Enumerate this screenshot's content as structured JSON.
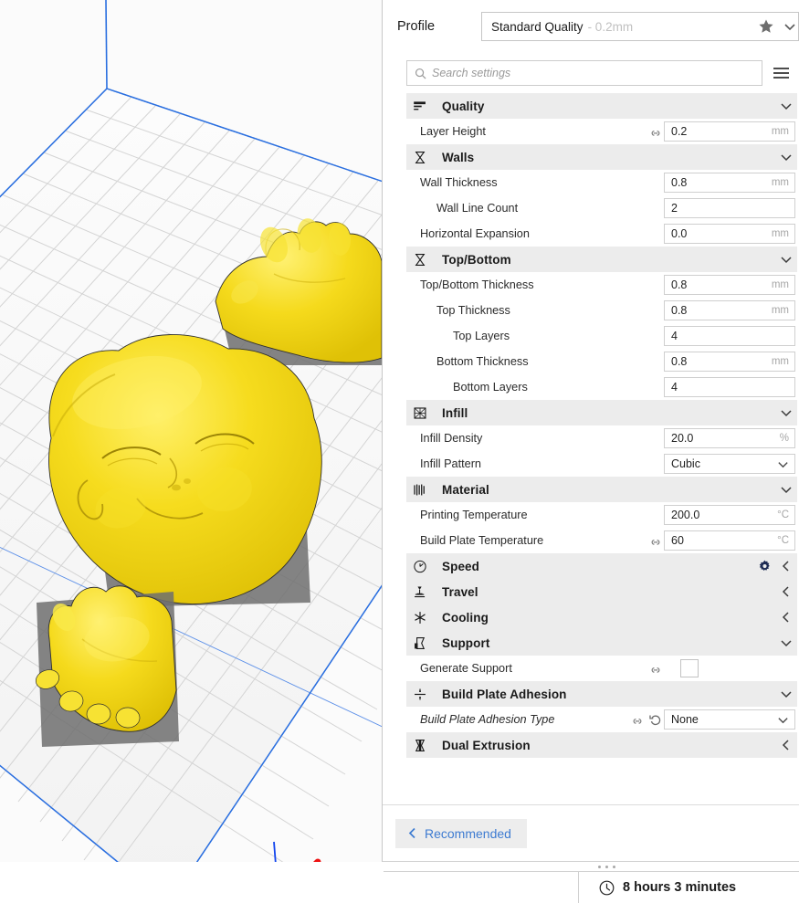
{
  "viewport": {
    "name": "3d-build-plate-viewport",
    "background_color": "#fbfbfb",
    "grid_color": "#d8d8d8",
    "plate_outline_color": "#1f5fd8",
    "model_color": "#f0d313",
    "model_shadow_color": "#6b6b6b",
    "axes": [
      {
        "name": "x-axis",
        "color": "#ee1111"
      },
      {
        "name": "y-axis",
        "color": "#11dd11"
      },
      {
        "name": "z-axis",
        "color": "#1144ee"
      }
    ]
  },
  "profile": {
    "label": "Profile",
    "selected": "Standard Quality",
    "variant": "- 0.2mm",
    "star_title": "Favorite"
  },
  "search": {
    "placeholder": "Search settings",
    "value": ""
  },
  "settings": [
    {
      "type": "category",
      "name": "quality",
      "label": "Quality",
      "icon": "quality-icon",
      "expanded": true,
      "has_gear": false
    },
    {
      "type": "setting",
      "name": "layer-height",
      "label": "Layer Height",
      "indent": 0,
      "control": "text",
      "value": "0.2",
      "unit": "mm",
      "linked": true,
      "reverted": false,
      "italic": false
    },
    {
      "type": "category",
      "name": "walls",
      "label": "Walls",
      "icon": "walls-icon",
      "expanded": true,
      "has_gear": false
    },
    {
      "type": "setting",
      "name": "wall-thickness",
      "label": "Wall Thickness",
      "indent": 0,
      "control": "text",
      "value": "0.8",
      "unit": "mm",
      "linked": false,
      "reverted": false,
      "italic": false
    },
    {
      "type": "setting",
      "name": "wall-line-count",
      "label": "Wall Line Count",
      "indent": 1,
      "control": "text",
      "value": "2",
      "unit": "",
      "linked": false,
      "reverted": false,
      "italic": false
    },
    {
      "type": "setting",
      "name": "horizontal-expansion",
      "label": "Horizontal Expansion",
      "indent": 0,
      "control": "text",
      "value": "0.0",
      "unit": "mm",
      "linked": false,
      "reverted": false,
      "italic": false
    },
    {
      "type": "category",
      "name": "top-bottom",
      "label": "Top/Bottom",
      "icon": "top-bottom-icon",
      "expanded": true,
      "has_gear": false
    },
    {
      "type": "setting",
      "name": "top-bottom-thickness",
      "label": "Top/Bottom Thickness",
      "indent": 0,
      "control": "text",
      "value": "0.8",
      "unit": "mm",
      "linked": false,
      "reverted": false,
      "italic": false
    },
    {
      "type": "setting",
      "name": "top-thickness",
      "label": "Top Thickness",
      "indent": 1,
      "control": "text",
      "value": "0.8",
      "unit": "mm",
      "linked": false,
      "reverted": false,
      "italic": false
    },
    {
      "type": "setting",
      "name": "top-layers",
      "label": "Top Layers",
      "indent": 2,
      "control": "text",
      "value": "4",
      "unit": "",
      "linked": false,
      "reverted": false,
      "italic": false
    },
    {
      "type": "setting",
      "name": "bottom-thickness",
      "label": "Bottom Thickness",
      "indent": 1,
      "control": "text",
      "value": "0.8",
      "unit": "mm",
      "linked": false,
      "reverted": false,
      "italic": false
    },
    {
      "type": "setting",
      "name": "bottom-layers",
      "label": "Bottom Layers",
      "indent": 2,
      "control": "text",
      "value": "4",
      "unit": "",
      "linked": false,
      "reverted": false,
      "italic": false
    },
    {
      "type": "category",
      "name": "infill",
      "label": "Infill",
      "icon": "infill-icon",
      "expanded": true,
      "has_gear": false
    },
    {
      "type": "setting",
      "name": "infill-density",
      "label": "Infill Density",
      "indent": 0,
      "control": "text",
      "value": "20.0",
      "unit": "%",
      "linked": false,
      "reverted": false,
      "italic": false
    },
    {
      "type": "setting",
      "name": "infill-pattern",
      "label": "Infill Pattern",
      "indent": 0,
      "control": "dropdown",
      "value": "Cubic",
      "unit": "",
      "linked": false,
      "reverted": false,
      "italic": false
    },
    {
      "type": "category",
      "name": "material",
      "label": "Material",
      "icon": "material-icon",
      "expanded": true,
      "has_gear": false
    },
    {
      "type": "setting",
      "name": "printing-temperature",
      "label": "Printing Temperature",
      "indent": 0,
      "control": "text",
      "value": "200.0",
      "unit": "°C",
      "linked": false,
      "reverted": false,
      "italic": false
    },
    {
      "type": "setting",
      "name": "build-plate-temperature",
      "label": "Build Plate Temperature",
      "indent": 0,
      "control": "text",
      "value": "60",
      "unit": "°C",
      "linked": true,
      "reverted": false,
      "italic": false
    },
    {
      "type": "category",
      "name": "speed",
      "label": "Speed",
      "icon": "speed-icon",
      "expanded": false,
      "has_gear": true
    },
    {
      "type": "category",
      "name": "travel",
      "label": "Travel",
      "icon": "travel-icon",
      "expanded": false,
      "has_gear": false
    },
    {
      "type": "category",
      "name": "cooling",
      "label": "Cooling",
      "icon": "cooling-icon",
      "expanded": false,
      "has_gear": false
    },
    {
      "type": "category",
      "name": "support",
      "label": "Support",
      "icon": "support-icon",
      "expanded": true,
      "has_gear": false
    },
    {
      "type": "setting",
      "name": "generate-support",
      "label": "Generate Support",
      "indent": 0,
      "control": "checkbox",
      "value": "",
      "unit": "",
      "checked": false,
      "linked": true,
      "reverted": false,
      "italic": false
    },
    {
      "type": "category",
      "name": "build-plate-adhesion",
      "label": "Build Plate Adhesion",
      "icon": "adhesion-icon",
      "expanded": true,
      "has_gear": false
    },
    {
      "type": "setting",
      "name": "build-plate-adhesion-type",
      "label": "Build Plate Adhesion Type",
      "indent": 0,
      "control": "dropdown",
      "value": "None",
      "unit": "",
      "linked": true,
      "reverted": true,
      "italic": true
    },
    {
      "type": "category",
      "name": "dual-extrusion",
      "label": "Dual Extrusion",
      "icon": "dual-extrusion-icon",
      "expanded": false,
      "has_gear": false
    }
  ],
  "footer": {
    "recommended_label": "Recommended"
  },
  "bottom_bar": {
    "time_estimate": "8 hours 3 minutes"
  },
  "colors": {
    "accent_link": "#3d7bd1",
    "category_bg": "#ececec",
    "model_yellow": "#f0d313"
  }
}
